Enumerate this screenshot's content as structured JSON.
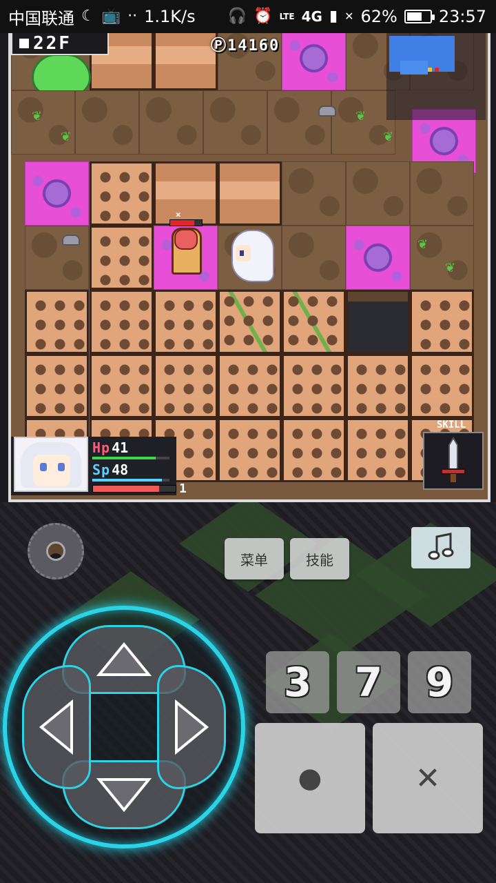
{
  "status_bar": {
    "carrier": "中国联通",
    "net_speed": "1.1K/s",
    "lte_label": "LTE",
    "network_4g": "4G",
    "battery_percent": "62%",
    "battery_level": 0.62,
    "time": "23:57"
  },
  "game": {
    "floor_label": "22F",
    "gold": "14160",
    "enemy_hp_fraction": 0.75,
    "player": {
      "hp_label": "Hp",
      "hp_value": "41",
      "hp_fraction": 0.82,
      "sp_label": "Sp",
      "sp_value": "48",
      "sp_fraction": 0.9,
      "exp_fraction": 0.8,
      "level": "1"
    },
    "skill_label": "SKILL"
  },
  "controls": {
    "menu_label": "菜单",
    "skill_button_label": "技能",
    "num_buttons": [
      "3",
      "7",
      "9"
    ],
    "confirm_symbol": "●",
    "cancel_symbol": "✕",
    "music_icon": "music-note-icon",
    "accent_color": "#2ad4e6"
  }
}
